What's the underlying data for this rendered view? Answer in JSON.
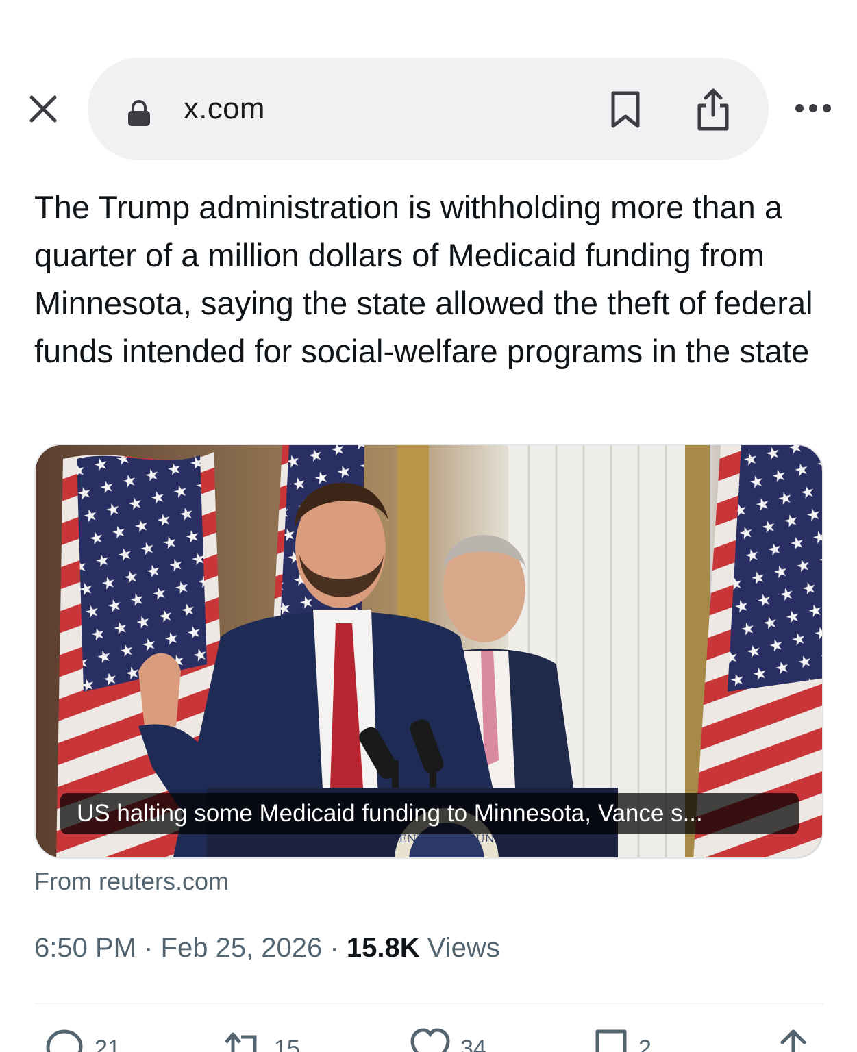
{
  "browser": {
    "url": "x.com",
    "icons": {
      "close": "close-icon",
      "lock": "lock-icon",
      "bookmark": "bookmark-icon",
      "share": "share-icon",
      "more": "more-icon"
    }
  },
  "tweet": {
    "text": "The Trump administration is withholding more than a quarter of a million dollars of Medicaid funding from Minnesota, saying the state allowed the theft of federal funds intended for social-welfare programs in the state",
    "card": {
      "caption": "US halting some Medicaid funding to Minnesota, Vance s...",
      "source": "From reuters.com",
      "seal_text": "ENT OF THE UN"
    },
    "time": "6:50 PM",
    "separator": "·",
    "date": "Feb 25, 2026",
    "views_count": "15.8K",
    "views_label": "Views",
    "actions": {
      "replies": "21",
      "reposts": "15",
      "likes": "34",
      "bookmarks": "2"
    }
  },
  "colors": {
    "text_primary": "#0f1419",
    "text_secondary": "#536471",
    "urlbar_bg": "#f0f1f3"
  }
}
